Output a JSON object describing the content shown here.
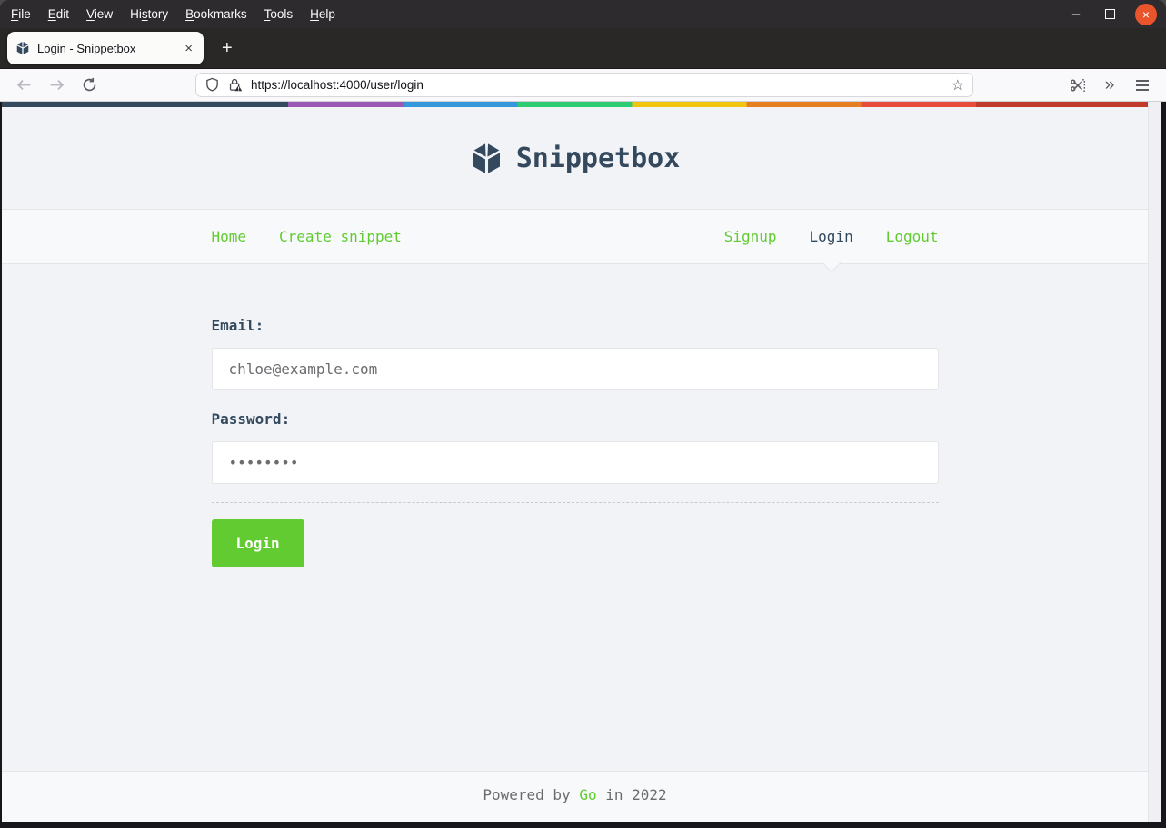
{
  "window": {
    "menu": [
      {
        "pre": "",
        "u": "F",
        "post": "ile"
      },
      {
        "pre": "",
        "u": "E",
        "post": "dit"
      },
      {
        "pre": "",
        "u": "V",
        "post": "iew"
      },
      {
        "pre": "Hi",
        "u": "s",
        "post": "tory"
      },
      {
        "pre": "",
        "u": "B",
        "post": "ookmarks"
      },
      {
        "pre": "",
        "u": "T",
        "post": "ools"
      },
      {
        "pre": "",
        "u": "H",
        "post": "elp"
      }
    ],
    "controls": {
      "minimize_glyph": "–",
      "close_glyph": "×"
    }
  },
  "tabbar": {
    "active_tab": {
      "title": "Login - Snippetbox",
      "close_glyph": "×"
    },
    "new_tab_glyph": "+"
  },
  "toolbar": {
    "url": "https://localhost:4000/user/login",
    "star_glyph": "☆",
    "overflow_glyph": "»"
  },
  "page": {
    "brand": "Snippetbox",
    "nav": {
      "left": [
        {
          "label": "Home"
        },
        {
          "label": "Create snippet"
        }
      ],
      "right": [
        {
          "label": "Signup"
        },
        {
          "label": "Login"
        },
        {
          "label": "Logout"
        }
      ]
    },
    "form": {
      "email_label": "Email:",
      "email_value": "chloe@example.com",
      "password_label": "Password:",
      "password_value": "••••••••",
      "submit_label": "Login"
    },
    "footer": {
      "pre": "Powered by ",
      "link_label": "Go",
      "post": " in 2022"
    }
  },
  "colors": {
    "accent_green": "#62CB31",
    "brand_navy": "#34495E",
    "close_button_orange": "#E9542B",
    "page_background": "#F1F3F6",
    "panel_background": "#F7F9FA",
    "stripe": [
      "#34495E",
      "#9B59B6",
      "#3498DB",
      "#2ECC71",
      "#F1C40F",
      "#E67E22",
      "#E74C3C",
      "#C0392B"
    ]
  }
}
